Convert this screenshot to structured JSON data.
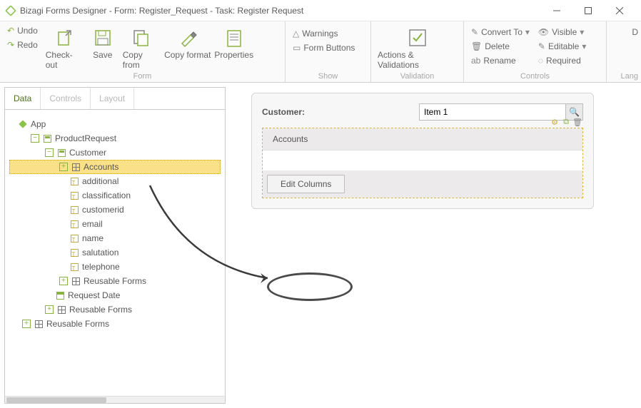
{
  "window": {
    "title": "Bizagi Forms Designer  - Form:  Register_Request - Task:  Register Request"
  },
  "ribbon": {
    "form": {
      "undo": "Undo",
      "redo": "Redo",
      "checkout": "Check-out",
      "save": "Save",
      "copyfrom": "Copy from",
      "copyformat": "Copy format",
      "properties": "Properties",
      "group": "Form"
    },
    "show": {
      "warnings": "Warnings",
      "formbuttons": "Form Buttons",
      "group": "Show"
    },
    "validation": {
      "actions": "Actions & Validations",
      "group": "Validation"
    },
    "controls": {
      "convertto": "Convert To",
      "delete": "Delete",
      "rename": "Rename",
      "visible": "Visible",
      "editable": "Editable",
      "required": "Required",
      "group": "Controls"
    },
    "lang": {
      "d": "D",
      "group": "Lang"
    }
  },
  "sidebar": {
    "tabs": {
      "data": "Data",
      "controls": "Controls",
      "layout": "Layout"
    },
    "tree": {
      "app": "App",
      "productRequest": "ProductRequest",
      "customer": "Customer",
      "accounts": "Accounts",
      "additional": "additional",
      "classification": "classification",
      "customerid": "customerid",
      "email": "email",
      "name": "name",
      "salutation": "salutation",
      "telephone": "telephone",
      "reusable1": "Reusable Forms",
      "requestDate": "Request Date",
      "reusable2": "Reusable Forms",
      "reusable3": "Reusable Forms"
    }
  },
  "form": {
    "customerLabel": "Customer:",
    "customerValue": "Item 1",
    "tableHeader": "Accounts",
    "editColumns": "Edit Columns"
  }
}
